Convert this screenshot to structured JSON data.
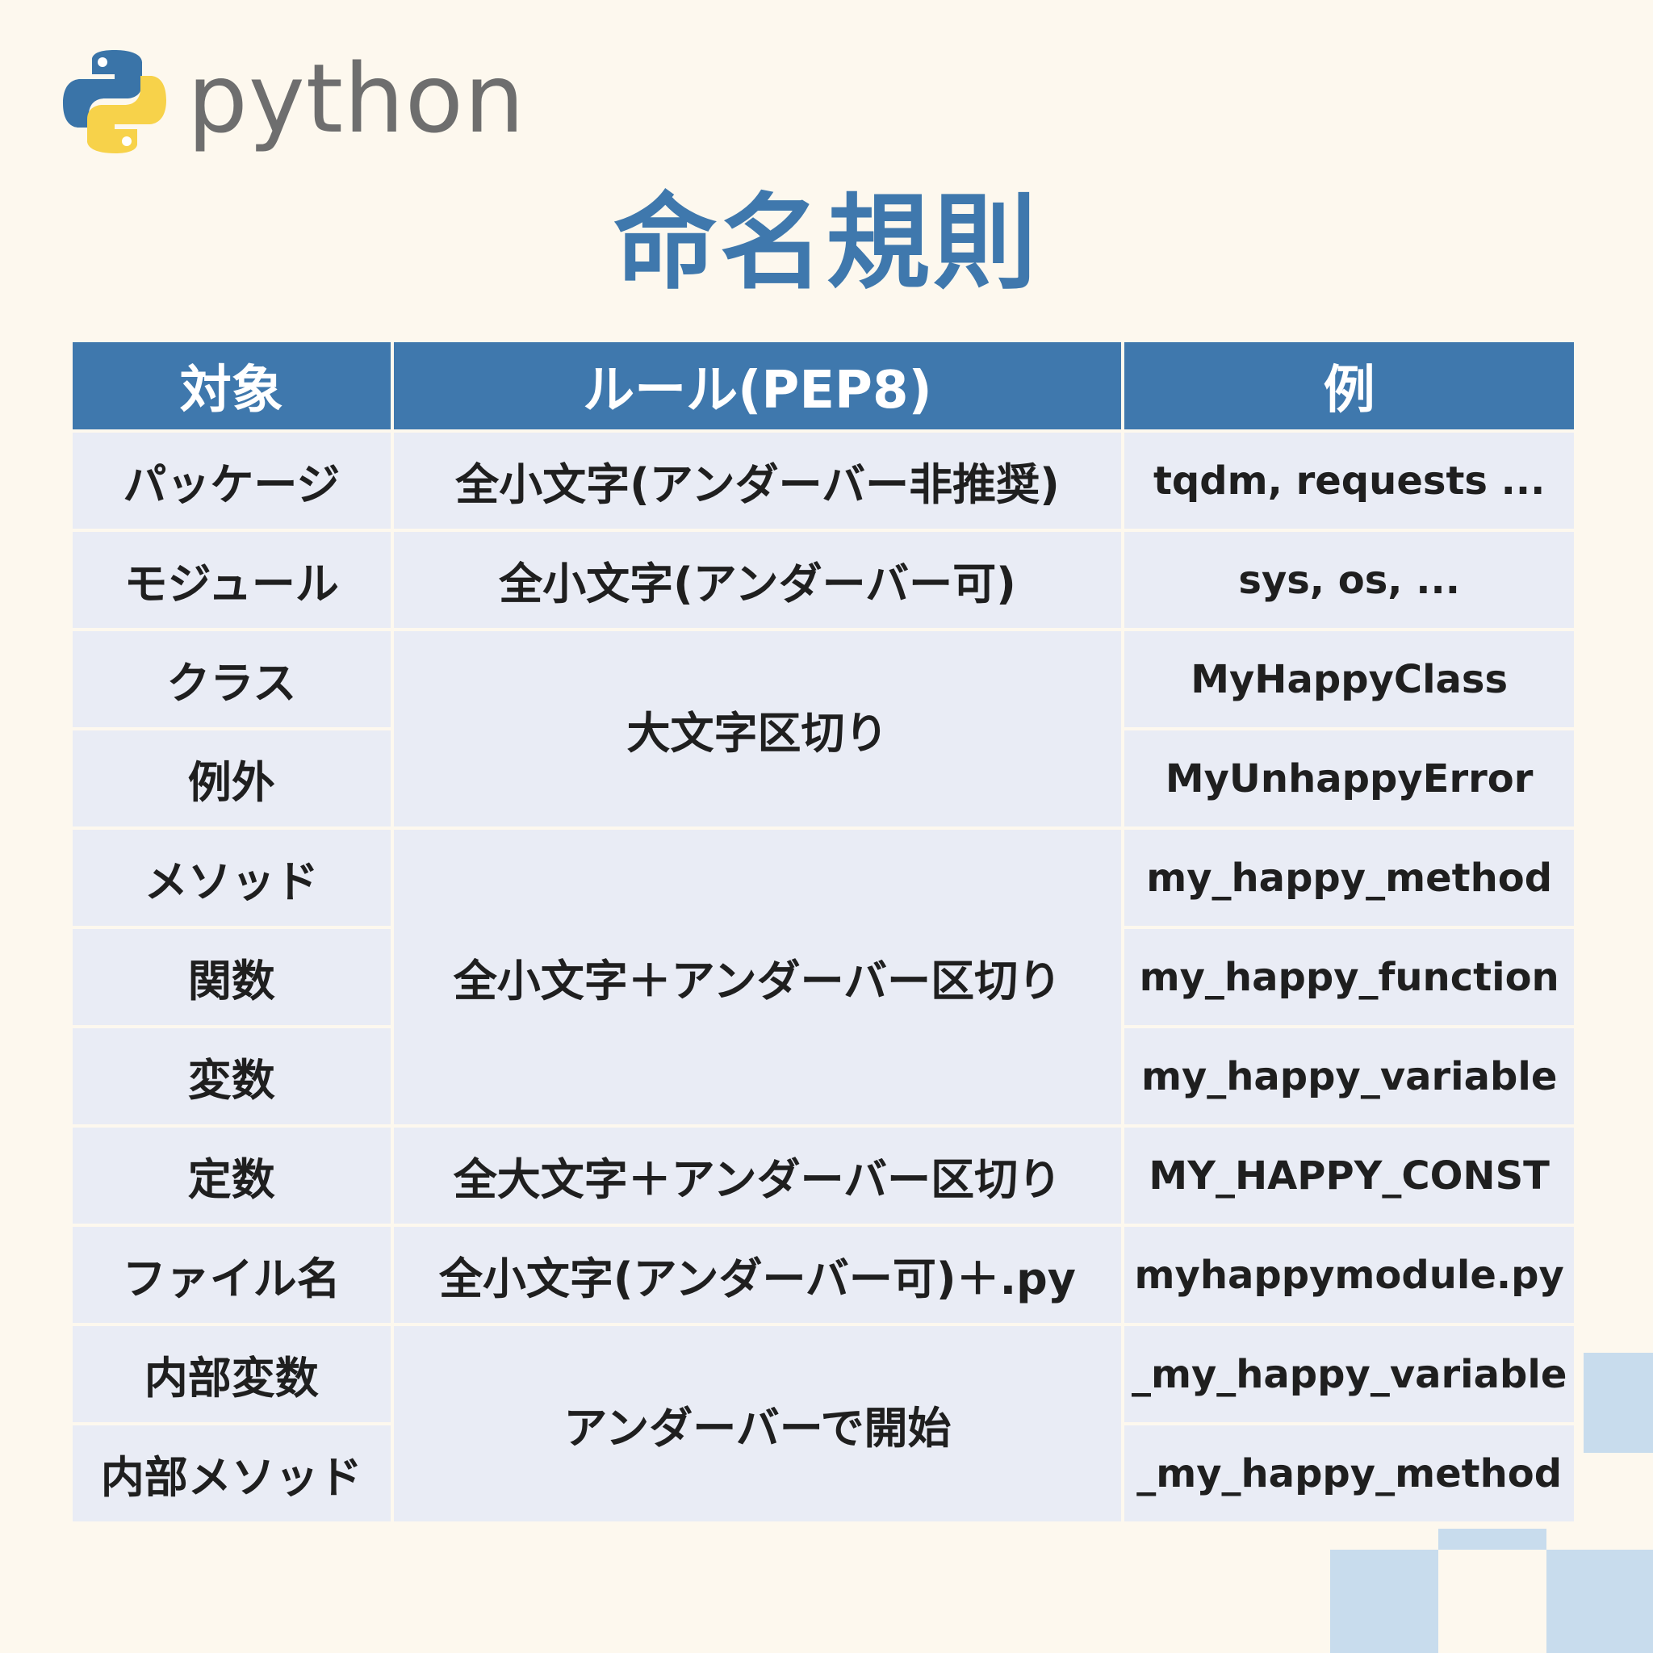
{
  "logo": {
    "text": "python",
    "icon": "python-logo-icon",
    "colors": {
      "blue": "#3a74a8",
      "yellow": "#f7d24a"
    }
  },
  "title": "命名規則",
  "table": {
    "headers": [
      "対象",
      "ルール(PEP8)",
      "例"
    ],
    "rows": [
      {
        "target": "パッケージ",
        "rule": "全小文字(アンダーバー非推奨)",
        "example": "tqdm, requests ..."
      },
      {
        "target": "モジュール",
        "rule": "全小文字(アンダーバー可)",
        "example": "sys, os, ..."
      },
      {
        "target": "クラス",
        "rule": "大文字区切り",
        "example": "MyHappyClass"
      },
      {
        "target": "例外",
        "example": "MyUnhappyError"
      },
      {
        "target": "メソッド",
        "rule": "全小文字＋アンダーバー区切り",
        "example": "my_happy_method"
      },
      {
        "target": "関数",
        "example": "my_happy_function"
      },
      {
        "target": "変数",
        "example": "my_happy_variable"
      },
      {
        "target": "定数",
        "rule": "全大文字＋アンダーバー区切り",
        "example": "MY_HAPPY_CONST"
      },
      {
        "target": "ファイル名",
        "rule": "全小文字(アンダーバー可)＋.py",
        "example": "myhappymodule.py"
      },
      {
        "target": "内部変数",
        "rule": "アンダーバーで開始",
        "example": "_my_happy_variable"
      },
      {
        "target": "内部メソッド",
        "example": "_my_happy_method"
      }
    ]
  },
  "colors": {
    "background": "#fdf8ee",
    "header": "#3f78ad",
    "cell": "#e9ecf5",
    "title": "#3f78ad",
    "decoration": "#c8dced"
  }
}
